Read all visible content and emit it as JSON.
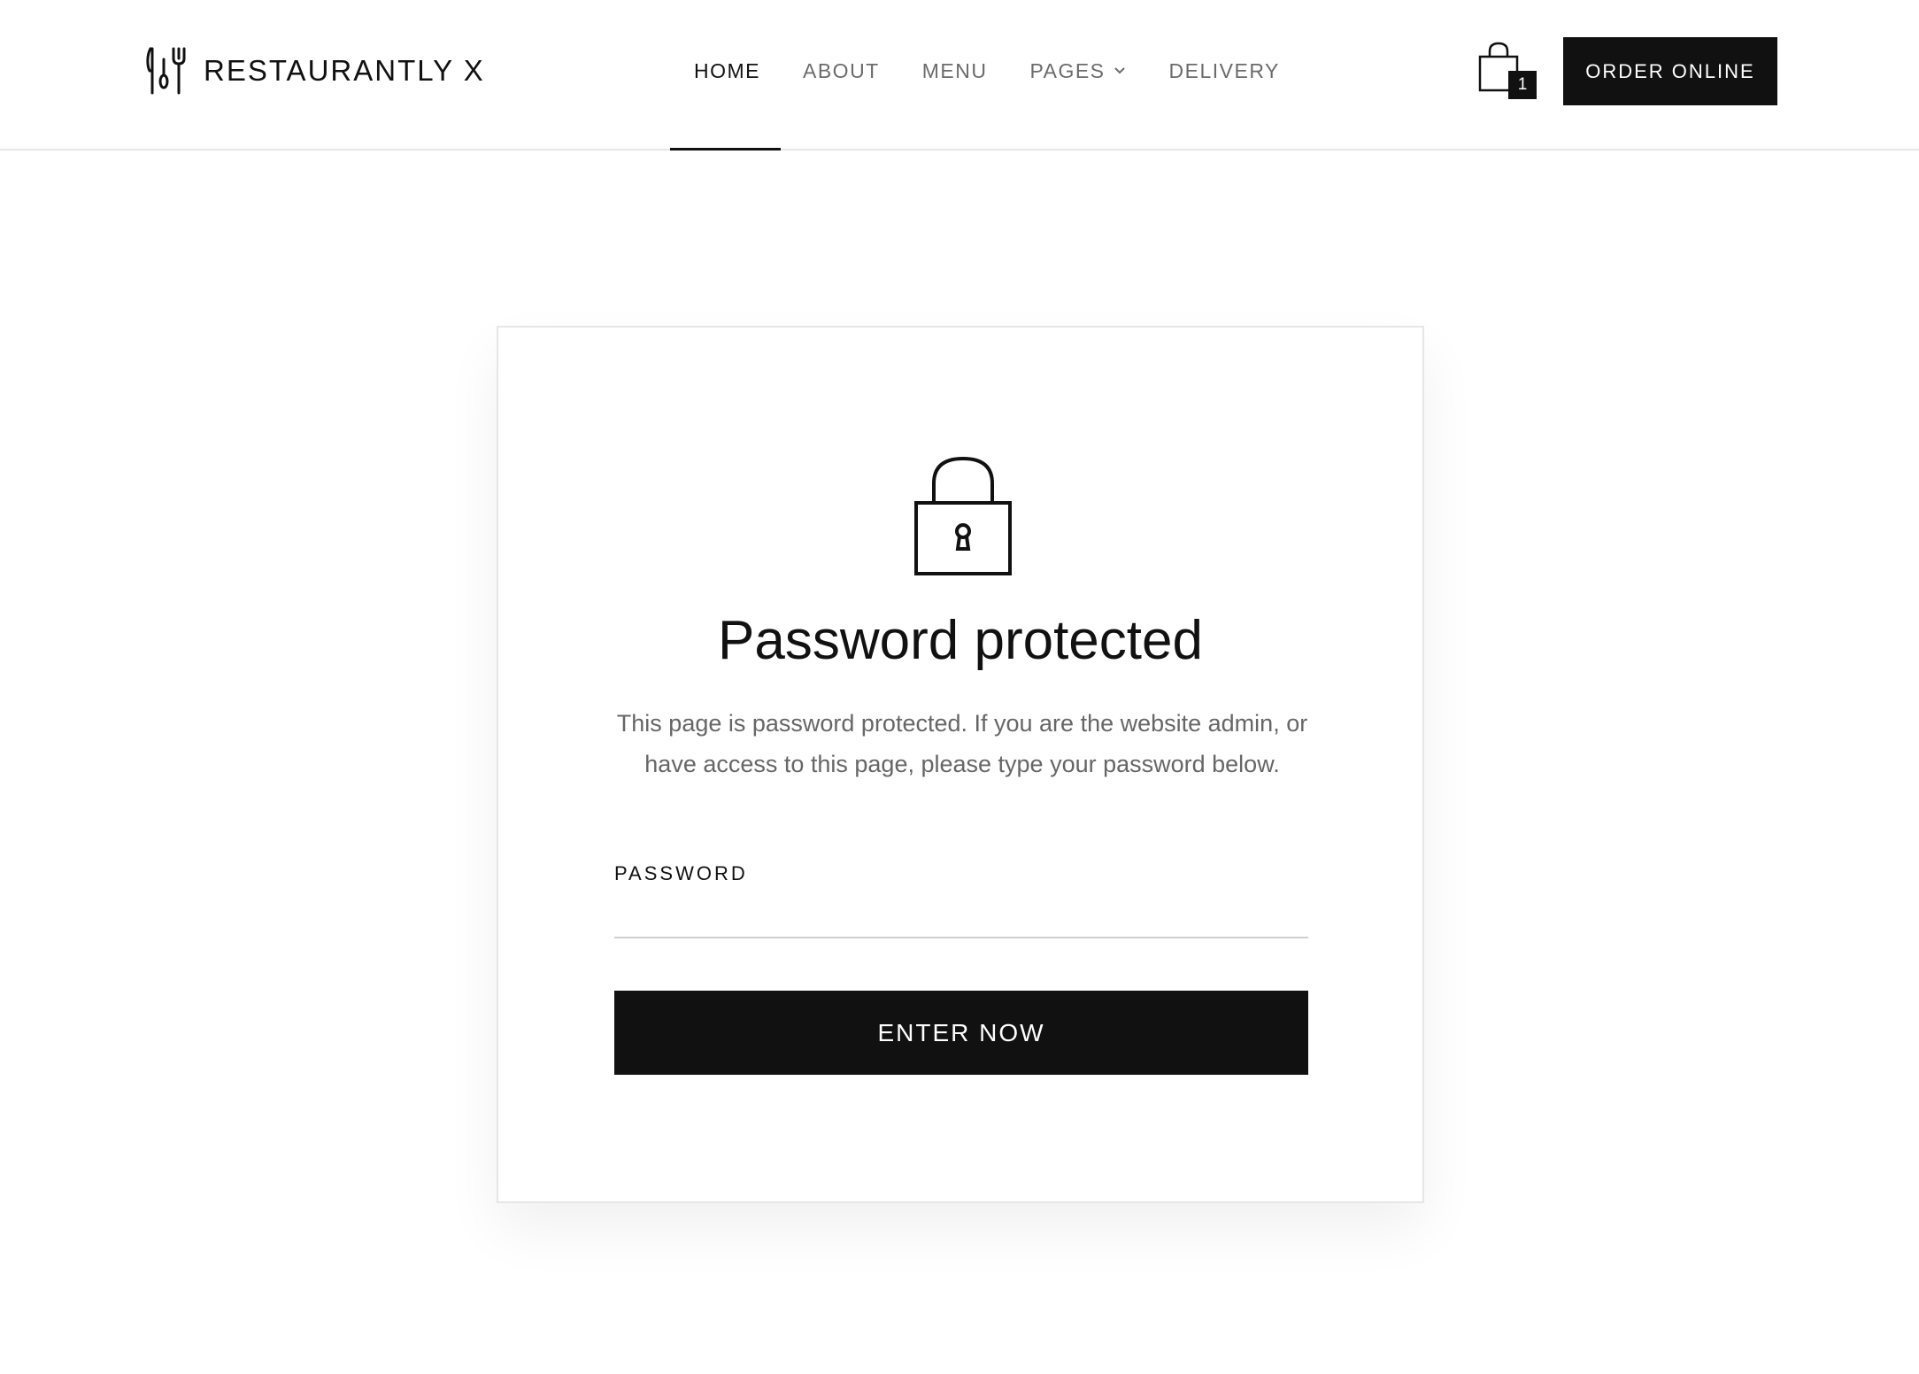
{
  "header": {
    "logo_icon": "cutlery-icon",
    "brand": "RESTAURANTLY X",
    "nav": [
      {
        "label": "HOME",
        "active": true
      },
      {
        "label": "ABOUT",
        "active": false
      },
      {
        "label": "MENU",
        "active": false
      },
      {
        "label": "PAGES",
        "active": false,
        "has_dropdown": true
      },
      {
        "label": "DELIVERY",
        "active": false
      }
    ],
    "cart": {
      "icon": "shopping-bag-icon",
      "count": "1"
    },
    "order_button": "ORDER ONLINE"
  },
  "card": {
    "icon": "lock-icon",
    "title": "Password protected",
    "description": "This page is password protected. If you are the website admin, or have access to this page, please type your password below.",
    "password_label": "PASSWORD",
    "password_value": "",
    "submit_label": "ENTER NOW"
  },
  "colors": {
    "primary": "#111111",
    "text_muted": "#6b6b6b",
    "border": "#e6e6e6",
    "background": "#ffffff"
  }
}
